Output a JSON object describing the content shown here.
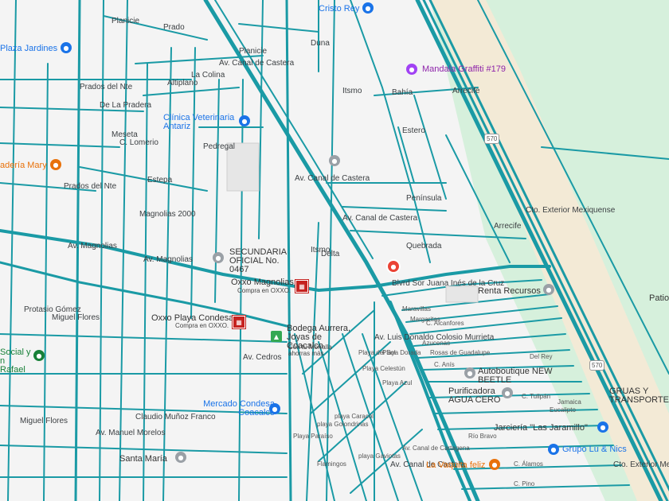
{
  "map": {
    "colors": {
      "background": "#f4f4f4",
      "road": "#1a9aa5",
      "park": "#d6f0dc",
      "beach": "#f3ead6"
    },
    "pois": {
      "cristo_rey": "Cristo Rey",
      "plaza_jardines": "Plaza Jardines",
      "mandala": "Mandala Graffiti #179",
      "clinica": "Clínica Veterinaria Antariz",
      "panaderia": "adería Mary",
      "secundaria": "SECUNDARIA OFICIAL No. 0467",
      "oxxo_magnolias": "Oxxo Magnolias",
      "oxxo_magnolias_sub": "Compra en OXXO.",
      "oxxo_playa": "Oxxo Playa Condesa",
      "oxxo_playa_sub": "Compra en OXXO.",
      "bodega": "Bodega Aurrera, Joyas de Coacalco",
      "bodega_sub": "Con tu Morralla ahorras más",
      "renta": "Renta Recursos",
      "autoboutique": "Autoboutique NEW BEETLE",
      "purificadora": "Purificadora AGUA CERO",
      "jarcieria": "Jarciería \"Las Jaramillo\"",
      "grupo_lu": "Grupo Lu & Nics",
      "vaquita": "La Vaquita feliz",
      "mercado": "Mercado Condesa Coacalco",
      "santa_maria": "Santa María",
      "social": "Social y n Rafael",
      "gruas": "GRUAS Y TRANSPORTES...",
      "patio": "Patio"
    },
    "roads": {
      "planicie1": "Planicie",
      "planicie2": "Planicie",
      "prado": "Prado",
      "duna": "Duna",
      "itsmo1": "Itsmo",
      "itsmo2": "Itsmo",
      "canal1": "Av. Canal de Castera",
      "canal2": "Av. Canal de Castera",
      "canal3": "Av. Canal de Castera",
      "canal4": "Av. Canal de Castera",
      "prados_nte1": "Prados del Nte",
      "prados_nte2": "Prados del Nte",
      "pradera": "De La Pradera",
      "lomerio": "C. Lomerio",
      "meseta": "Meseta",
      "estepa": "Estepa",
      "pedregal": "Pedregal",
      "altiplano": "Altiplano",
      "colina": "La Colina",
      "magnolias2000": "Magnolias 2000",
      "av_magnolias1": "Av. Magnolias",
      "av_magnolias2": "Av. Magnolias",
      "bahia": "Bahía",
      "arrecife1": "Arrecife",
      "arrecife2": "Arrecife",
      "estero": "Estero",
      "peninsula": "Península",
      "quebrada": "Quebrada",
      "delta": "Delta",
      "blvd": "Blvrd Sor Juana Inés de la Cruz",
      "exterior1": "Cto. Exterior Mexiquense",
      "exterior2": "Cto. Exterior Mexiquense",
      "maravillas": "Maravillas",
      "margaritas": "Margaritas",
      "alcanfores": "C. Alcanfores",
      "azucenas": "Azucenas",
      "rosas": "Rosas de Guadalupe",
      "anis": "C. Anís",
      "delrey": "Del Rey",
      "luis_donaldo": "Av. Luis Donaldo Colosio Murrieta",
      "playa_del_sol": "Playa del Sol",
      "playa_dorada": "Playa Dorada",
      "playa_azul": "Playa Azul",
      "playa_celestun": "Playa Celestún",
      "playa_paraiso": "Playa Paraíso",
      "playa_golondrinas": "playa Golondrinas",
      "playa_caracol": "playa Caracol",
      "flamingos": "Flamingos",
      "playa_gaviotas": "playa Gaviotas",
      "protasio": "Protasio Gómez",
      "miguel_flores1": "Miguel Flores",
      "miguel_flores2": "Miguel Flores",
      "manuel_morelos": "Av. Manuel Morelos",
      "claudio": "Claudio Muñoz Franco",
      "av_cedros": "Av. Cedros",
      "rio_bravo": "Río Bravo",
      "tulipan": "C. Tulipán",
      "jamaica": "Jamaica",
      "eucalipto": "Eucalipto",
      "alamos": "C. Álamos",
      "pino": "C. Pino",
      "canal_cartagena": "Av. Canal de Cartagena",
      "shield1": "570",
      "shield2": "570"
    }
  }
}
